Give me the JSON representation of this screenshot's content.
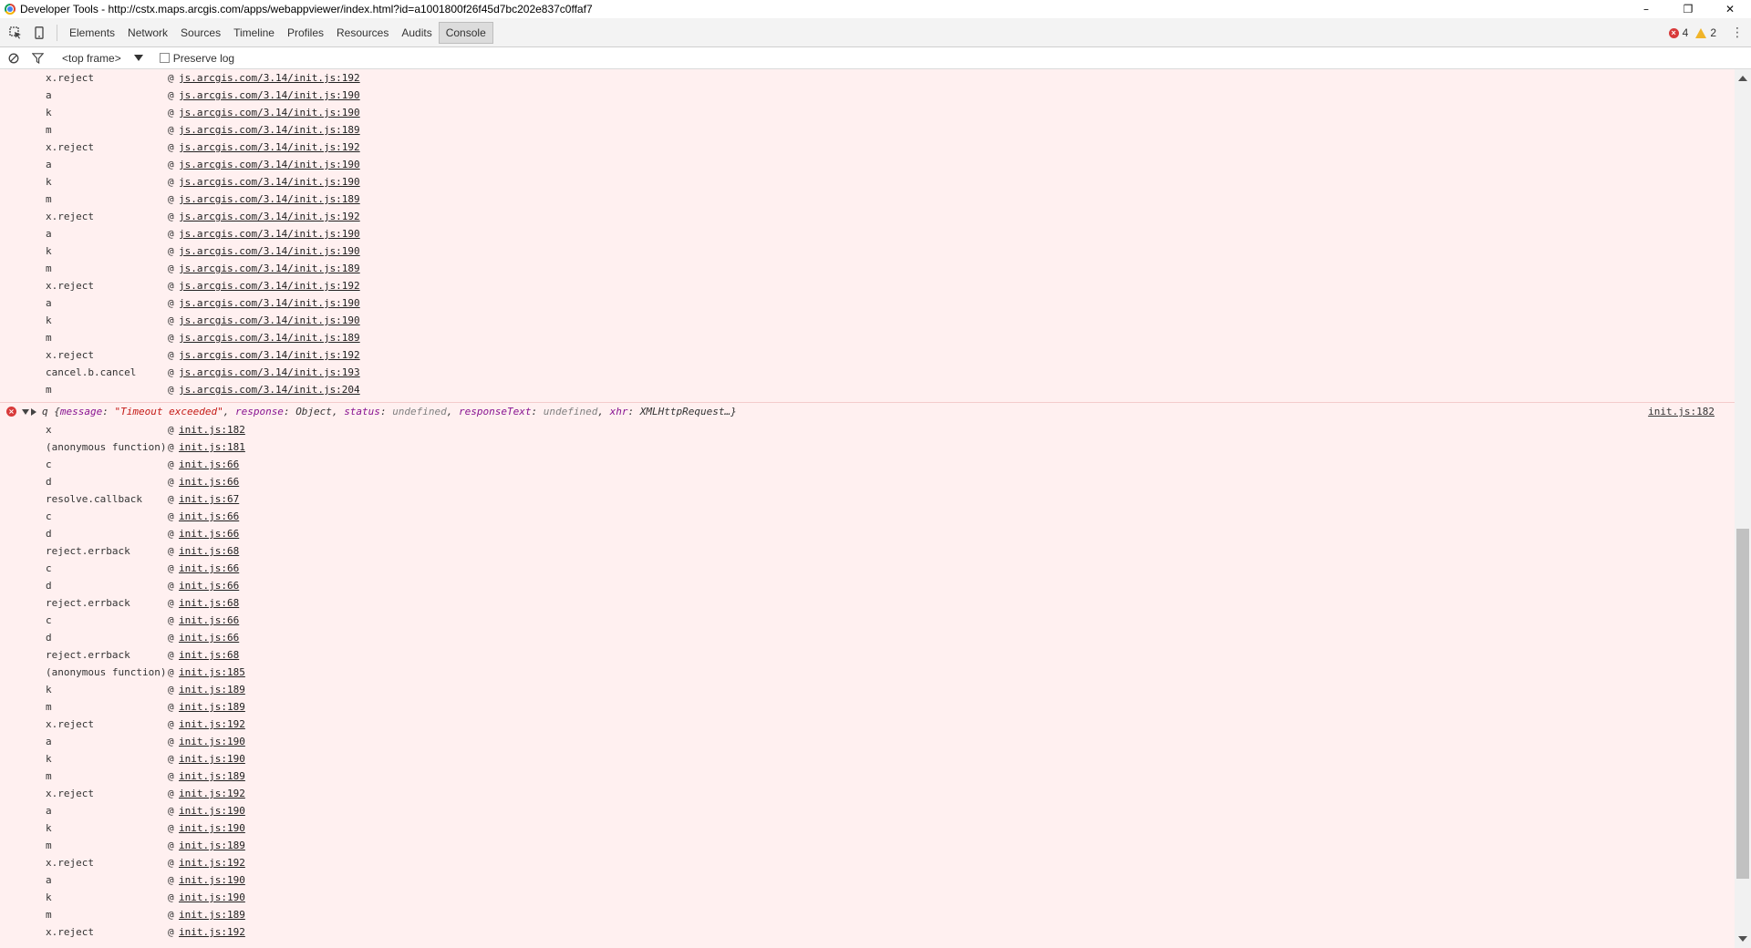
{
  "window": {
    "title": "Developer Tools - http://cstx.maps.arcgis.com/apps/webappviewer/index.html?id=a1001800f26f45d7bc202e837c0ffaf7",
    "minimize": "–",
    "restore": "❐",
    "close": "✕"
  },
  "tabs": [
    {
      "label": "Elements"
    },
    {
      "label": "Network"
    },
    {
      "label": "Sources"
    },
    {
      "label": "Timeline"
    },
    {
      "label": "Profiles"
    },
    {
      "label": "Resources"
    },
    {
      "label": "Audits"
    },
    {
      "label": "Console"
    }
  ],
  "active_tab": "Console",
  "counts": {
    "errors": "4",
    "warnings": "2"
  },
  "kebab": "⋮",
  "toolbar": {
    "frame": "<top frame>",
    "preserve_log": "Preserve log"
  },
  "console": {
    "first_group": [
      {
        "fn": "x.reject",
        "loc": "js.arcgis.com/3.14/init.js:192"
      },
      {
        "fn": "a",
        "loc": "js.arcgis.com/3.14/init.js:190"
      },
      {
        "fn": "k",
        "loc": "js.arcgis.com/3.14/init.js:190"
      },
      {
        "fn": "m",
        "loc": "js.arcgis.com/3.14/init.js:189"
      },
      {
        "fn": "x.reject",
        "loc": "js.arcgis.com/3.14/init.js:192"
      },
      {
        "fn": "a",
        "loc": "js.arcgis.com/3.14/init.js:190"
      },
      {
        "fn": "k",
        "loc": "js.arcgis.com/3.14/init.js:190"
      },
      {
        "fn": "m",
        "loc": "js.arcgis.com/3.14/init.js:189"
      },
      {
        "fn": "x.reject",
        "loc": "js.arcgis.com/3.14/init.js:192"
      },
      {
        "fn": "a",
        "loc": "js.arcgis.com/3.14/init.js:190"
      },
      {
        "fn": "k",
        "loc": "js.arcgis.com/3.14/init.js:190"
      },
      {
        "fn": "m",
        "loc": "js.arcgis.com/3.14/init.js:189"
      },
      {
        "fn": "x.reject",
        "loc": "js.arcgis.com/3.14/init.js:192"
      },
      {
        "fn": "a",
        "loc": "js.arcgis.com/3.14/init.js:190"
      },
      {
        "fn": "k",
        "loc": "js.arcgis.com/3.14/init.js:190"
      },
      {
        "fn": "m",
        "loc": "js.arcgis.com/3.14/init.js:189"
      },
      {
        "fn": "x.reject",
        "loc": "js.arcgis.com/3.14/init.js:192"
      },
      {
        "fn": "cancel.b.cancel",
        "loc": "js.arcgis.com/3.14/init.js:193"
      },
      {
        "fn": "m",
        "loc": "js.arcgis.com/3.14/init.js:204"
      }
    ],
    "error": {
      "prefix": "q {",
      "message_key": "message",
      "message_value": "\"Timeout exceeded\"",
      "response_key": "response",
      "response_value": "Object",
      "status_key": "status",
      "status_value": "undefined",
      "responseText_key": "responseText",
      "responseText_value": "undefined",
      "xhr_key": "xhr",
      "xhr_value": "XMLHttpRequest",
      "suffix": "…}",
      "source": "init.js:182"
    },
    "second_group": [
      {
        "fn": "x",
        "loc": "init.js:182"
      },
      {
        "fn": "(anonymous function)",
        "loc": "init.js:181"
      },
      {
        "fn": "c",
        "loc": "init.js:66"
      },
      {
        "fn": "d",
        "loc": "init.js:66"
      },
      {
        "fn": "resolve.callback",
        "loc": "init.js:67"
      },
      {
        "fn": "c",
        "loc": "init.js:66"
      },
      {
        "fn": "d",
        "loc": "init.js:66"
      },
      {
        "fn": "reject.errback",
        "loc": "init.js:68"
      },
      {
        "fn": "c",
        "loc": "init.js:66"
      },
      {
        "fn": "d",
        "loc": "init.js:66"
      },
      {
        "fn": "reject.errback",
        "loc": "init.js:68"
      },
      {
        "fn": "c",
        "loc": "init.js:66"
      },
      {
        "fn": "d",
        "loc": "init.js:66"
      },
      {
        "fn": "reject.errback",
        "loc": "init.js:68"
      },
      {
        "fn": "(anonymous function)",
        "loc": "init.js:185"
      },
      {
        "fn": "k",
        "loc": "init.js:189"
      },
      {
        "fn": "m",
        "loc": "init.js:189"
      },
      {
        "fn": "x.reject",
        "loc": "init.js:192"
      },
      {
        "fn": "a",
        "loc": "init.js:190"
      },
      {
        "fn": "k",
        "loc": "init.js:190"
      },
      {
        "fn": "m",
        "loc": "init.js:189"
      },
      {
        "fn": "x.reject",
        "loc": "init.js:192"
      },
      {
        "fn": "a",
        "loc": "init.js:190"
      },
      {
        "fn": "k",
        "loc": "init.js:190"
      },
      {
        "fn": "m",
        "loc": "init.js:189"
      },
      {
        "fn": "x.reject",
        "loc": "init.js:192"
      },
      {
        "fn": "a",
        "loc": "init.js:190"
      },
      {
        "fn": "k",
        "loc": "init.js:190"
      },
      {
        "fn": "m",
        "loc": "init.js:189"
      },
      {
        "fn": "x.reject",
        "loc": "init.js:192"
      }
    ]
  },
  "colors": {
    "error_background": "#fff0f0",
    "error_icon": "#d83a3a",
    "warning_icon": "#f0b429"
  }
}
